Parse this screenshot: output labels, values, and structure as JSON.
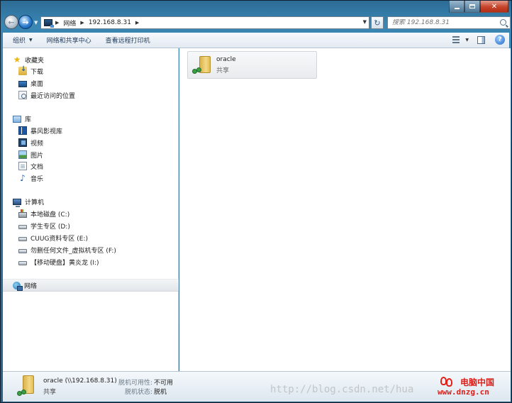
{
  "address": {
    "crumbs": [
      "网络",
      "192.168.8.31"
    ]
  },
  "search": {
    "placeholder": "搜索 192.168.8.31"
  },
  "toolbar": {
    "organize": "组织",
    "network_center": "网络和共享中心",
    "printers": "查看远程打印机"
  },
  "sidebar": {
    "favorites": "收藏夹",
    "downloads": "下载",
    "desktop": "桌面",
    "recent": "最近访问的位置",
    "libraries": "库",
    "storm_video": "暴风影视库",
    "videos": "视频",
    "pictures": "图片",
    "documents": "文档",
    "music": "音乐",
    "computer": "计算机",
    "drive_c": "本地磁盘 (C:)",
    "drive_d": "学生专区 (D:)",
    "drive_e": "CUUG资料专区 (E:)",
    "drive_f": "勿删任何文件_虚拟机专区 (F:)",
    "drive_i": "【移动硬盘】黄炎龙 (I:)",
    "network": "网络"
  },
  "content": {
    "item_name": "oracle",
    "item_type": "共享"
  },
  "details": {
    "title": "oracle (\\\\192.168.8.31)",
    "type": "共享",
    "offline_avail_label": "脱机可用性:",
    "offline_avail_value": "不可用",
    "offline_status_label": "脱机状态:",
    "offline_status_value": "脱机"
  },
  "watermark": "http://blog.csdn.net/hua",
  "brand": {
    "name": "电脑中国",
    "url": "www.dnzg.cn"
  },
  "colors": {
    "accent": "#2c6b95",
    "selection": "#e2e6ea",
    "brand_red": "#d8221c"
  }
}
